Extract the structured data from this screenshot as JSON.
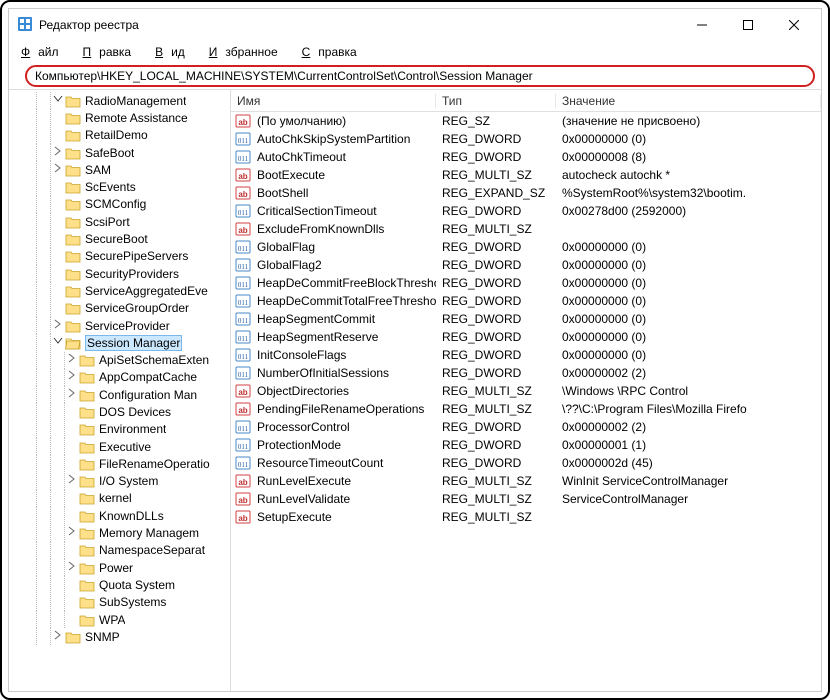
{
  "window": {
    "title": "Редактор реестра"
  },
  "menu": {
    "file": "Файл",
    "edit": "Правка",
    "view": "Вид",
    "fav": "Избранное",
    "help": "Справка"
  },
  "address": "Компьютер\\HKEY_LOCAL_MACHINE\\SYSTEM\\CurrentControlSet\\Control\\Session Manager",
  "tree": [
    {
      "d": 3,
      "exp": "v",
      "n": "RadioManagement"
    },
    {
      "d": 3,
      "exp": "",
      "n": "Remote Assistance"
    },
    {
      "d": 3,
      "exp": "",
      "n": "RetailDemo"
    },
    {
      "d": 3,
      "exp": ">",
      "n": "SafeBoot"
    },
    {
      "d": 3,
      "exp": ">",
      "n": "SAM"
    },
    {
      "d": 3,
      "exp": "",
      "n": "ScEvents"
    },
    {
      "d": 3,
      "exp": "",
      "n": "SCMConfig"
    },
    {
      "d": 3,
      "exp": "",
      "n": "ScsiPort"
    },
    {
      "d": 3,
      "exp": "",
      "n": "SecureBoot"
    },
    {
      "d": 3,
      "exp": "",
      "n": "SecurePipeServers"
    },
    {
      "d": 3,
      "exp": "",
      "n": "SecurityProviders"
    },
    {
      "d": 3,
      "exp": "",
      "n": "ServiceAggregatedEve"
    },
    {
      "d": 3,
      "exp": "",
      "n": "ServiceGroupOrder"
    },
    {
      "d": 3,
      "exp": ">",
      "n": "ServiceProvider"
    },
    {
      "d": 3,
      "exp": "v",
      "n": "Session Manager",
      "sel": true,
      "open": true
    },
    {
      "d": 4,
      "exp": ">",
      "n": "ApiSetSchemaExten"
    },
    {
      "d": 4,
      "exp": ">",
      "n": "AppCompatCache"
    },
    {
      "d": 4,
      "exp": ">",
      "n": "Configuration Man"
    },
    {
      "d": 4,
      "exp": "",
      "n": "DOS Devices"
    },
    {
      "d": 4,
      "exp": "",
      "n": "Environment"
    },
    {
      "d": 4,
      "exp": "",
      "n": "Executive"
    },
    {
      "d": 4,
      "exp": "",
      "n": "FileRenameOperatio"
    },
    {
      "d": 4,
      "exp": ">",
      "n": "I/O System"
    },
    {
      "d": 4,
      "exp": "",
      "n": "kernel"
    },
    {
      "d": 4,
      "exp": "",
      "n": "KnownDLLs"
    },
    {
      "d": 4,
      "exp": ">",
      "n": "Memory Managem"
    },
    {
      "d": 4,
      "exp": "",
      "n": "NamespaceSeparat"
    },
    {
      "d": 4,
      "exp": ">",
      "n": "Power"
    },
    {
      "d": 4,
      "exp": "",
      "n": "Quota System"
    },
    {
      "d": 4,
      "exp": "",
      "n": "SubSystems"
    },
    {
      "d": 4,
      "exp": "",
      "n": "WPA"
    },
    {
      "d": 3,
      "exp": ">",
      "n": "SNMP"
    }
  ],
  "columns": {
    "name": "Имя",
    "type": "Тип",
    "value": "Значение"
  },
  "values": [
    {
      "icon": "ab",
      "n": "(По умолчанию)",
      "t": "REG_SZ",
      "v": "(значение не присвоено)"
    },
    {
      "icon": "num",
      "n": "AutoChkSkipSystemPartition",
      "t": "REG_DWORD",
      "v": "0x00000000 (0)"
    },
    {
      "icon": "num",
      "n": "AutoChkTimeout",
      "t": "REG_DWORD",
      "v": "0x00000008 (8)"
    },
    {
      "icon": "ab",
      "n": "BootExecute",
      "t": "REG_MULTI_SZ",
      "v": "autocheck autochk *"
    },
    {
      "icon": "ab",
      "n": "BootShell",
      "t": "REG_EXPAND_SZ",
      "v": "%SystemRoot%\\system32\\bootim."
    },
    {
      "icon": "num",
      "n": "CriticalSectionTimeout",
      "t": "REG_DWORD",
      "v": "0x00278d00 (2592000)"
    },
    {
      "icon": "ab",
      "n": "ExcludeFromKnownDlls",
      "t": "REG_MULTI_SZ",
      "v": ""
    },
    {
      "icon": "num",
      "n": "GlobalFlag",
      "t": "REG_DWORD",
      "v": "0x00000000 (0)"
    },
    {
      "icon": "num",
      "n": "GlobalFlag2",
      "t": "REG_DWORD",
      "v": "0x00000000 (0)"
    },
    {
      "icon": "num",
      "n": "HeapDeCommitFreeBlockThreshold",
      "t": "REG_DWORD",
      "v": "0x00000000 (0)"
    },
    {
      "icon": "num",
      "n": "HeapDeCommitTotalFreeThreshold",
      "t": "REG_DWORD",
      "v": "0x00000000 (0)"
    },
    {
      "icon": "num",
      "n": "HeapSegmentCommit",
      "t": "REG_DWORD",
      "v": "0x00000000 (0)"
    },
    {
      "icon": "num",
      "n": "HeapSegmentReserve",
      "t": "REG_DWORD",
      "v": "0x00000000 (0)"
    },
    {
      "icon": "num",
      "n": "InitConsoleFlags",
      "t": "REG_DWORD",
      "v": "0x00000000 (0)"
    },
    {
      "icon": "num",
      "n": "NumberOfInitialSessions",
      "t": "REG_DWORD",
      "v": "0x00000002 (2)"
    },
    {
      "icon": "ab",
      "n": "ObjectDirectories",
      "t": "REG_MULTI_SZ",
      "v": "\\Windows \\RPC Control"
    },
    {
      "icon": "ab",
      "n": "PendingFileRenameOperations",
      "t": "REG_MULTI_SZ",
      "v": "\\??\\C:\\Program Files\\Mozilla Firefo"
    },
    {
      "icon": "num",
      "n": "ProcessorControl",
      "t": "REG_DWORD",
      "v": "0x00000002 (2)"
    },
    {
      "icon": "num",
      "n": "ProtectionMode",
      "t": "REG_DWORD",
      "v": "0x00000001 (1)"
    },
    {
      "icon": "num",
      "n": "ResourceTimeoutCount",
      "t": "REG_DWORD",
      "v": "0x0000002d (45)"
    },
    {
      "icon": "ab",
      "n": "RunLevelExecute",
      "t": "REG_MULTI_SZ",
      "v": "WinInit ServiceControlManager"
    },
    {
      "icon": "ab",
      "n": "RunLevelValidate",
      "t": "REG_MULTI_SZ",
      "v": "ServiceControlManager"
    },
    {
      "icon": "ab",
      "n": "SetupExecute",
      "t": "REG_MULTI_SZ",
      "v": ""
    }
  ]
}
